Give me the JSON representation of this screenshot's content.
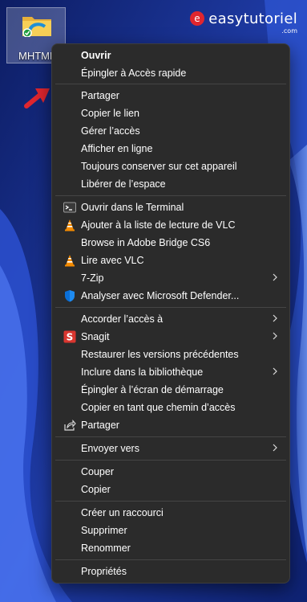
{
  "desktop": {
    "file_label": "MHTML",
    "watermark": {
      "brand": "easytutoriel",
      "tld": ".com"
    }
  },
  "menu": {
    "items": [
      {
        "label": "Ouvrir"
      },
      {
        "label": "Épingler à Accès rapide"
      },
      {
        "label": "Partager"
      },
      {
        "label": "Copier le lien"
      },
      {
        "label": "Gérer l’accès"
      },
      {
        "label": "Afficher en ligne"
      },
      {
        "label": "Toujours conserver sur cet appareil"
      },
      {
        "label": "Libérer de l’espace"
      },
      {
        "label": "Ouvrir dans le Terminal",
        "icon": "terminal-icon"
      },
      {
        "label": "Ajouter à la liste de lecture de VLC",
        "icon": "vlc-cone-icon"
      },
      {
        "label": "Browse in Adobe Bridge CS6"
      },
      {
        "label": "Lire avec VLC",
        "icon": "vlc-cone-icon"
      },
      {
        "label": "7-Zip"
      },
      {
        "label": "Analyser avec Microsoft Defender...",
        "icon": "defender-shield-icon"
      },
      {
        "label": "Accorder l’accès à"
      },
      {
        "label": "Snagit",
        "icon": "snagit-icon"
      },
      {
        "label": "Restaurer les versions précédentes"
      },
      {
        "label": "Inclure dans la bibliothèque"
      },
      {
        "label": "Épingler à l’écran de démarrage"
      },
      {
        "label": "Copier en tant que chemin d’accès"
      },
      {
        "label": "Partager",
        "icon": "share-icon"
      },
      {
        "label": "Envoyer vers"
      },
      {
        "label": "Couper"
      },
      {
        "label": "Copier"
      },
      {
        "label": "Créer un raccourci"
      },
      {
        "label": "Supprimer"
      },
      {
        "label": "Renommer"
      },
      {
        "label": "Propriétés"
      }
    ]
  },
  "colors": {
    "menu_bg": "#2b2b2b",
    "menu_text": "#ffffff",
    "separator": "#454545",
    "vlc_orange": "#f48b00",
    "defender_blue": "#0a6fd8",
    "snagit_red": "#d9362f"
  }
}
